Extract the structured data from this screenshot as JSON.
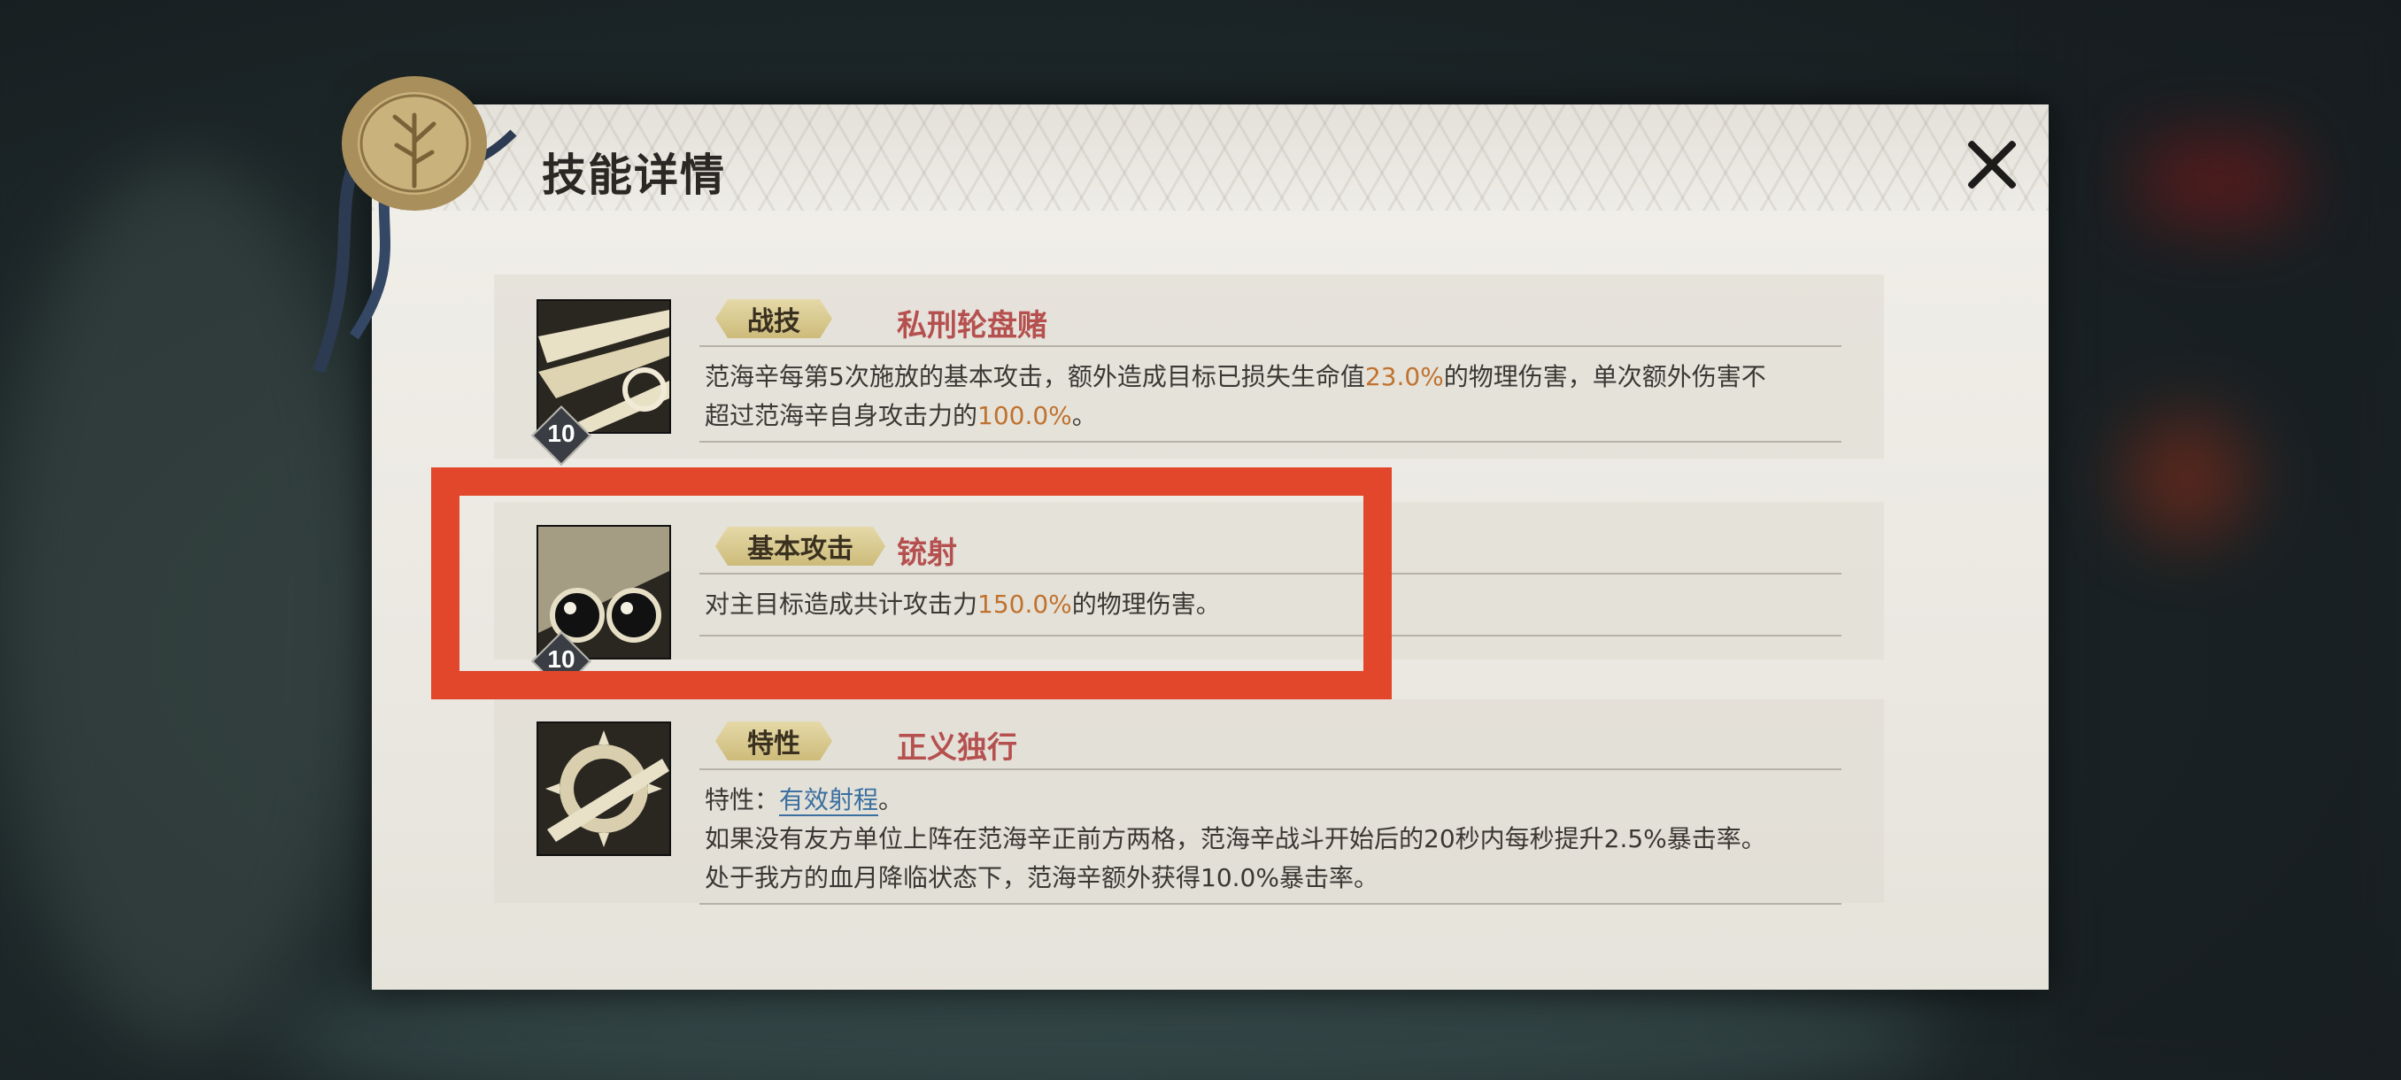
{
  "panel": {
    "title": "技能详情"
  },
  "skills": [
    {
      "tag": "战技",
      "name": "私刑轮盘赌",
      "level": "10",
      "desc": {
        "l1a": "范海辛每第5次施放的基本攻击，额外造成目标已损失生命值",
        "l1v": "23.0%",
        "l1b": "的物理伤害，单次额外伤害不",
        "l2a": "超过范海辛自身攻击力的",
        "l2v": "100.0%",
        "l2b": "。"
      }
    },
    {
      "tag": "基本攻击",
      "name": "铳射",
      "level": "10",
      "desc": {
        "l1a": "对主目标造成共计攻击力",
        "l1v": "150.0%",
        "l1b": "的物理伤害。"
      }
    },
    {
      "tag": "特性",
      "name": "正义独行",
      "desc": {
        "l1a": "特性：",
        "l1link": "有效射程",
        "l1b": "。",
        "l2": "如果没有友方单位上阵在范海辛正前方两格，范海辛战斗开始后的20秒内每秒提升2.5%暴击率。",
        "l3": "处于我方的血月降临状态下，范海辛额外获得10.0%暴击率。"
      }
    }
  ],
  "colors": {
    "accent_value": "#c0722e",
    "skill_name": "#b5504f",
    "link": "#3a6fa0",
    "highlight_box": "#e2472c"
  },
  "icons": {
    "close": "close-icon",
    "seal": "wax-seal-icon",
    "skill1": "slash-claw-icon",
    "skill2": "goggles-icon",
    "skill3": "rifle-emblem-icon"
  }
}
